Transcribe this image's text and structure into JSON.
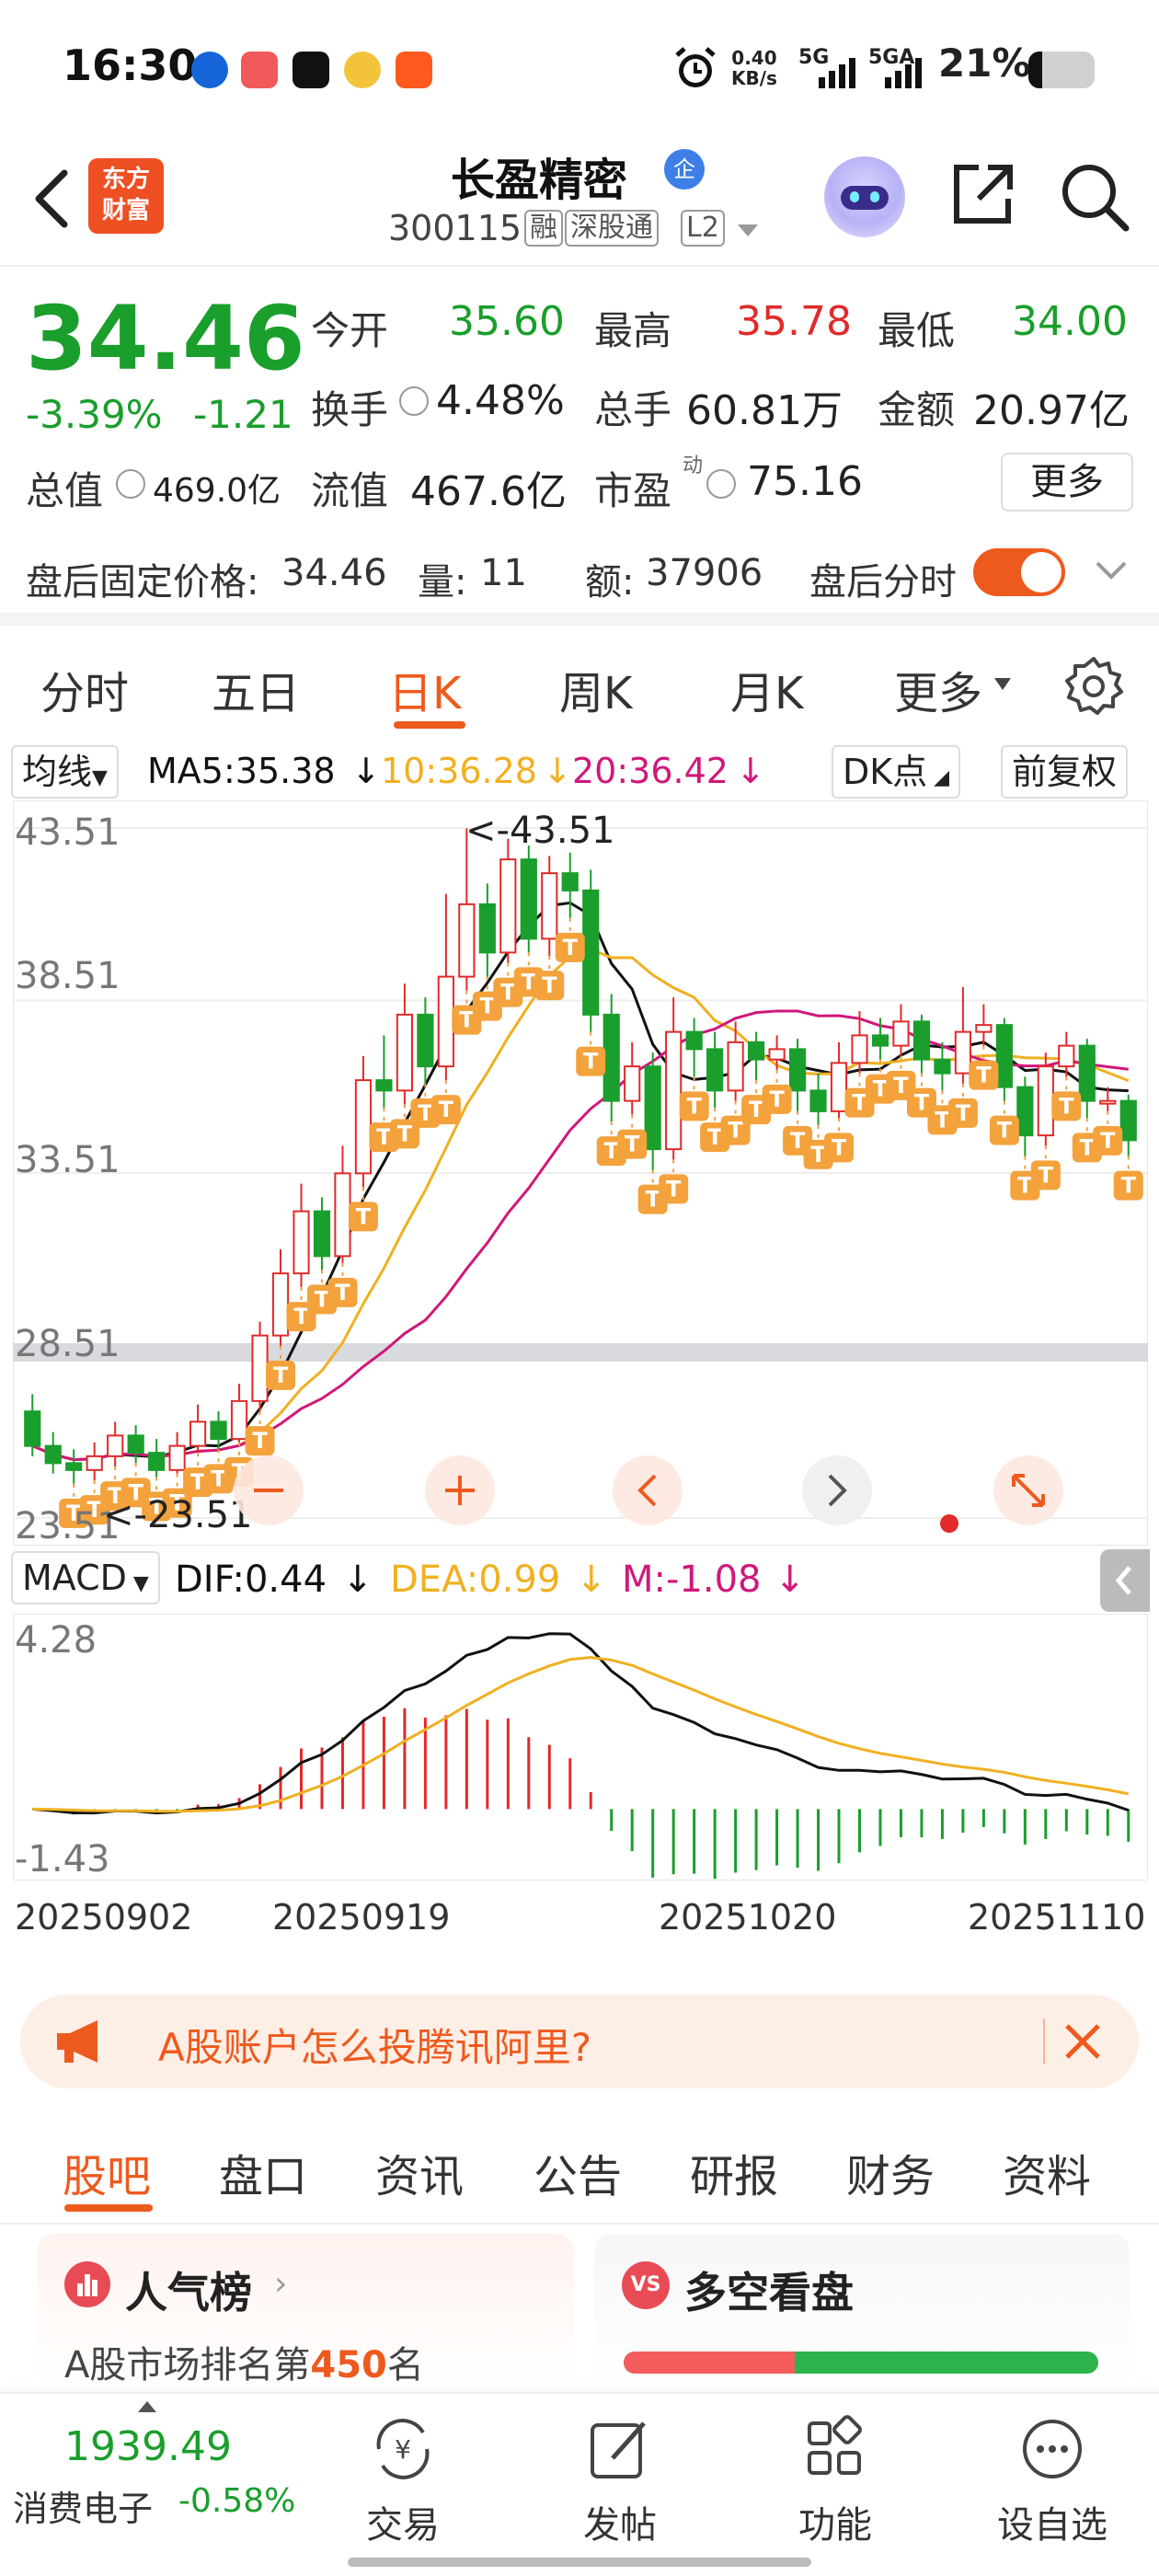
{
  "status_bar": {
    "time": "16:30",
    "net_speed_value": "0.40",
    "net_speed_unit": "KB/s",
    "signal1": "5G",
    "signal2": "5GA",
    "battery_pct": "21%",
    "battery_level": 0.21
  },
  "header": {
    "logo_line1": "东方",
    "logo_line2": "财富",
    "stock_name": "长盈精密",
    "badge": "企",
    "stock_code": "300115",
    "tags": [
      "融",
      "深股通",
      "L2"
    ]
  },
  "quote": {
    "price": "34.46",
    "change_pct": "-3.39%",
    "change_amt": "-1.21",
    "open_label": "今开",
    "open": "35.60",
    "high_label": "最高",
    "high": "35.78",
    "low_label": "最低",
    "low": "34.00",
    "turnover_label": "换手",
    "turnover": "4.48%",
    "volume_label": "总手",
    "volume": "60.81万",
    "amount_label": "金额",
    "amount": "20.97亿",
    "total_mv_label": "总值",
    "total_mv": "469.0亿",
    "float_mv_label": "流值",
    "float_mv": "467.6亿",
    "pe_label": "市盈",
    "pe_sup": "动",
    "pe": "75.16",
    "more": "更多",
    "post_price_label": "盘后固定价格:",
    "post_price": "34.46",
    "post_vol_label": "量:",
    "post_vol": "11",
    "post_amt_label": "额:",
    "post_amt": "37906",
    "post_timeshare": "盘后分时"
  },
  "chart_tabs": [
    "分时",
    "五日",
    "日K",
    "周K",
    "月K",
    "更多"
  ],
  "ma_bar": {
    "type": "均线",
    "ma5": "MA5:35.38",
    "ma10": "10:36.28",
    "ma20": "20:36.42",
    "dk": "DK点",
    "adjust": "前复权"
  },
  "kline": {
    "y_labels": [
      "43.51",
      "38.51",
      "33.51",
      "28.51",
      "23.51"
    ],
    "max_label": "<-43.51",
    "min_label": "<-23.51",
    "colors": {
      "up": "#e12a2a",
      "down": "#1a9e2c",
      "ma5": "#111111",
      "ma10": "#f0b020",
      "ma20": "#d0187a"
    }
  },
  "macd_bar": {
    "type": "MACD",
    "dif": "DIF:0.44",
    "dea": "DEA:0.99",
    "m": "M:-1.08"
  },
  "macd": {
    "y_top": "4.28",
    "y_bottom": "-1.43"
  },
  "dates": [
    "20250902",
    "20250919",
    "20251020",
    "20251110"
  ],
  "chart_data": {
    "type": "candlestick",
    "x": [
      "20250902",
      "20250919",
      "20251020",
      "20251110"
    ],
    "ylim": [
      23.51,
      43.51
    ],
    "yticks": [
      43.51,
      38.51,
      33.51,
      28.51,
      23.51
    ],
    "series": [
      {
        "name": "MA5",
        "last": 35.38
      },
      {
        "name": "MA10",
        "last": 36.28
      },
      {
        "name": "MA20",
        "last": 36.42
      }
    ],
    "candles": [
      [
        26.6,
        25.6,
        27.1,
        25.3
      ],
      [
        25.6,
        25.1,
        26.0,
        24.8
      ],
      [
        25.1,
        24.9,
        25.5,
        24.5
      ],
      [
        24.9,
        25.3,
        25.7,
        24.6
      ],
      [
        25.3,
        25.9,
        26.3,
        25.0
      ],
      [
        25.9,
        25.4,
        26.2,
        25.1
      ],
      [
        25.4,
        24.9,
        25.8,
        24.7
      ],
      [
        24.9,
        25.6,
        26.0,
        24.8
      ],
      [
        25.6,
        26.3,
        26.8,
        25.4
      ],
      [
        26.3,
        25.8,
        26.6,
        25.5
      ],
      [
        25.8,
        26.9,
        27.4,
        25.7
      ],
      [
        26.9,
        28.8,
        29.2,
        26.6
      ],
      [
        28.8,
        30.6,
        31.3,
        28.5
      ],
      [
        30.6,
        32.4,
        33.2,
        30.2
      ],
      [
        32.4,
        31.1,
        32.8,
        30.7
      ],
      [
        31.1,
        33.5,
        34.3,
        30.9
      ],
      [
        33.5,
        36.2,
        36.9,
        33.1
      ],
      [
        36.2,
        35.9,
        37.5,
        35.4
      ],
      [
        35.9,
        38.1,
        39.0,
        35.5
      ],
      [
        38.1,
        36.6,
        38.6,
        36.1
      ],
      [
        36.6,
        39.2,
        41.6,
        36.2
      ],
      [
        39.2,
        41.3,
        43.5,
        38.8
      ],
      [
        41.3,
        39.9,
        41.9,
        39.2
      ],
      [
        39.9,
        42.6,
        43.2,
        39.6
      ],
      [
        42.6,
        40.3,
        43.0,
        39.9
      ],
      [
        40.3,
        42.2,
        42.7,
        39.8
      ],
      [
        42.2,
        41.7,
        42.8,
        40.9
      ],
      [
        41.7,
        38.1,
        42.3,
        37.6
      ],
      [
        38.1,
        35.6,
        38.7,
        35.0
      ],
      [
        35.6,
        36.6,
        37.3,
        35.2
      ],
      [
        36.6,
        34.2,
        37.0,
        33.6
      ],
      [
        34.2,
        37.6,
        38.6,
        33.9
      ],
      [
        37.6,
        37.1,
        38.0,
        36.3
      ],
      [
        37.1,
        35.9,
        37.6,
        35.4
      ],
      [
        35.9,
        37.3,
        37.9,
        35.6
      ],
      [
        37.3,
        36.8,
        37.6,
        36.2
      ],
      [
        36.8,
        37.1,
        37.5,
        36.5
      ],
      [
        37.1,
        35.9,
        37.4,
        35.3
      ],
      [
        35.9,
        35.3,
        36.4,
        34.9
      ],
      [
        35.3,
        36.7,
        37.3,
        35.1
      ],
      [
        36.7,
        37.5,
        38.2,
        36.4
      ],
      [
        37.5,
        37.2,
        38.0,
        36.8
      ],
      [
        37.2,
        37.9,
        38.4,
        36.9
      ],
      [
        37.9,
        36.8,
        38.1,
        36.4
      ],
      [
        36.8,
        36.4,
        37.3,
        35.9
      ],
      [
        36.4,
        37.6,
        38.9,
        36.1
      ],
      [
        37.6,
        37.8,
        38.4,
        37.2
      ],
      [
        37.8,
        36.0,
        38.0,
        35.6
      ],
      [
        36.0,
        34.6,
        36.3,
        34.0
      ],
      [
        34.6,
        36.6,
        37.0,
        34.3
      ],
      [
        36.6,
        37.2,
        37.6,
        36.3
      ],
      [
        37.2,
        35.6,
        37.4,
        35.1
      ],
      [
        35.6,
        35.6,
        36.0,
        35.3
      ],
      [
        35.6,
        34.46,
        35.78,
        34.0
      ]
    ]
  },
  "ad": {
    "text": "A股账户怎么投腾讯阿里?"
  },
  "section_tabs": [
    "股吧",
    "盘口",
    "资讯",
    "公告",
    "研报",
    "财务",
    "资料"
  ],
  "cards": {
    "popularity_title": "人气榜",
    "popularity_prefix": "A股市场排名第",
    "popularity_rank": "450",
    "popularity_suffix": "名",
    "bullbear_title": "多空看盘",
    "bull_ratio": 0.36
  },
  "bottom_bar": {
    "index_value": "1939.49",
    "index_name": "消费电子",
    "index_change": "-0.58%",
    "items": [
      "交易",
      "发帖",
      "功能",
      "设自选"
    ]
  }
}
